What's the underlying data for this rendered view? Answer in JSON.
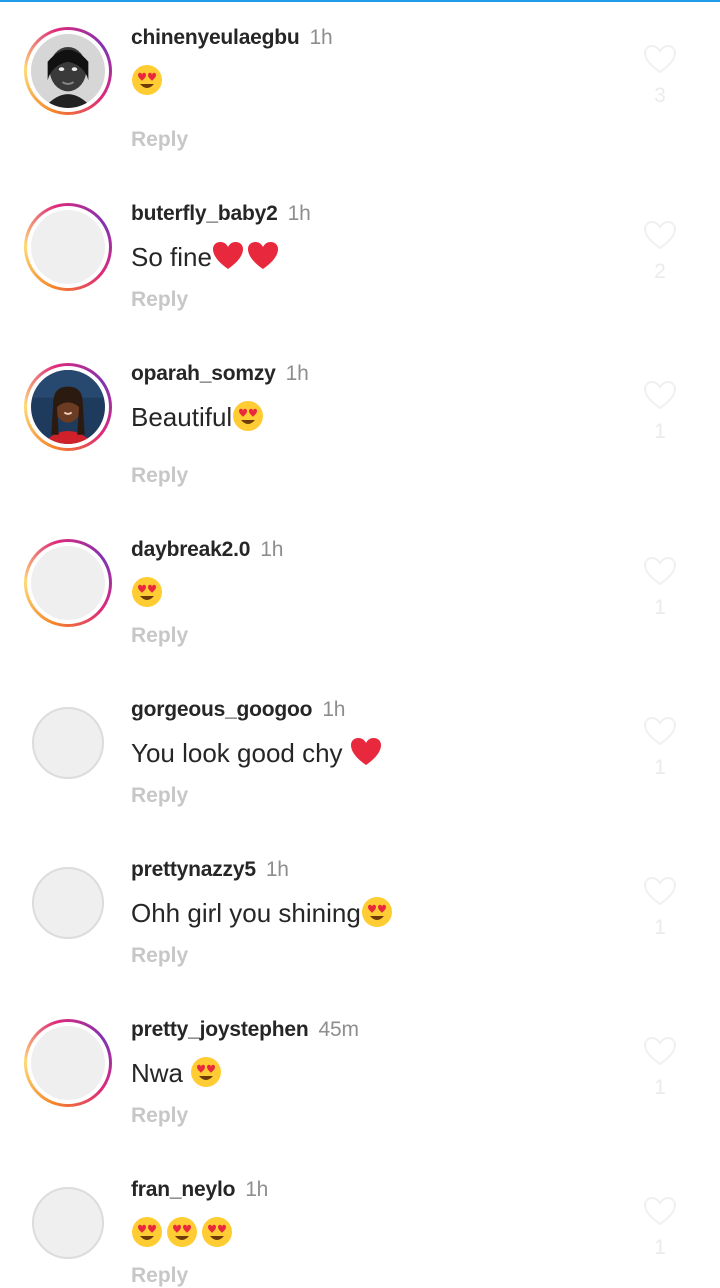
{
  "colors": {
    "accent_top": "#1e9be9",
    "username": "#262626",
    "timestamp": "#8e8e8e",
    "reply": "#c7c7c7",
    "like_count": "#ebebeb"
  },
  "comments": [
    {
      "username": "chinenyeulaegbu",
      "time": "1h",
      "text": "",
      "emojis": [
        "heart-eyes"
      ],
      "reply": "Reply",
      "likes": "3",
      "story_ring": true,
      "avatar": "photo-portrait-dark"
    },
    {
      "username": "buterfly_baby2",
      "time": "1h",
      "text": "So fine",
      "emojis": [
        "red-heart",
        "red-heart"
      ],
      "reply": "Reply",
      "likes": "2",
      "story_ring": true,
      "avatar": "default"
    },
    {
      "username": "oparah_somzy",
      "time": "1h",
      "text": "Beautiful",
      "emojis": [
        "heart-eyes"
      ],
      "reply": "Reply",
      "likes": "1",
      "story_ring": true,
      "avatar": "photo-portrait-red"
    },
    {
      "username": "daybreak2.0",
      "time": "1h",
      "text": "",
      "emojis": [
        "heart-eyes"
      ],
      "reply": "Reply",
      "likes": "1",
      "story_ring": true,
      "avatar": "default"
    },
    {
      "username": "gorgeous_googoo",
      "time": "1h",
      "text": "You look good chy ",
      "emojis": [
        "red-heart"
      ],
      "reply": "Reply",
      "likes": "1",
      "story_ring": false,
      "avatar": "default"
    },
    {
      "username": "prettynazzy5",
      "time": "1h",
      "text": "Ohh girl you shining",
      "emojis": [
        "heart-eyes"
      ],
      "reply": "Reply",
      "likes": "1",
      "story_ring": false,
      "avatar": "default"
    },
    {
      "username": "pretty_joystephen",
      "time": "45m",
      "text": "Nwa ",
      "emojis": [
        "heart-eyes"
      ],
      "reply": "Reply",
      "likes": "1",
      "story_ring": true,
      "avatar": "default"
    },
    {
      "username": "fran_neylo",
      "time": "1h",
      "text": "",
      "emojis": [
        "heart-eyes",
        "heart-eyes",
        "heart-eyes"
      ],
      "reply": "Reply",
      "likes": "1",
      "story_ring": false,
      "avatar": "default"
    }
  ]
}
